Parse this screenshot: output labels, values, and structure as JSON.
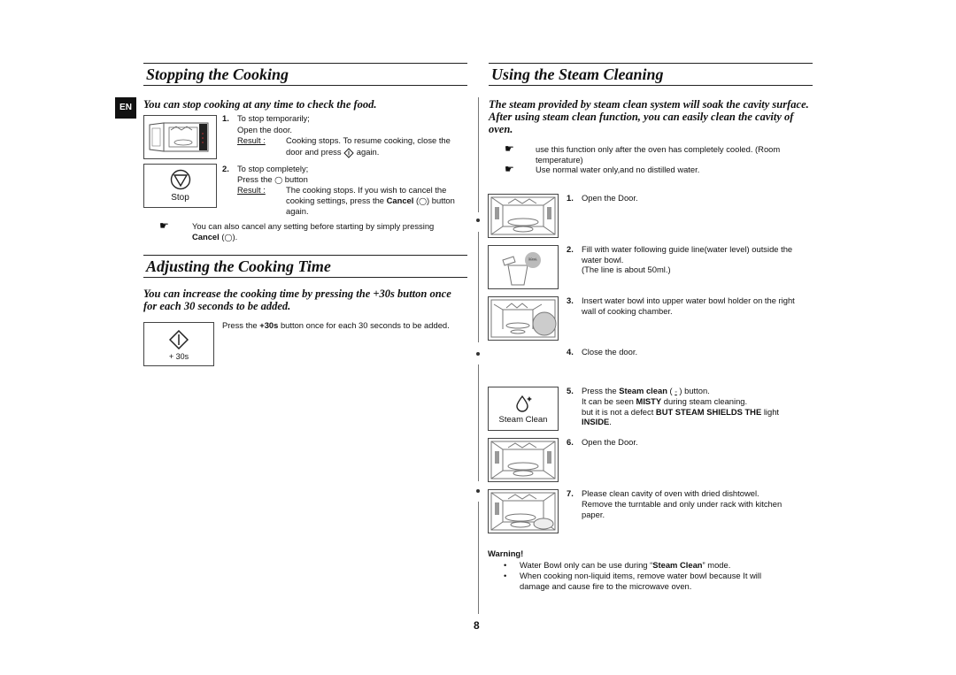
{
  "language_tab": "EN",
  "page_number": "8",
  "left": {
    "stopping": {
      "title": "Stopping the Cooking",
      "intro": "You can stop cooking at any time to check the food.",
      "step1": {
        "num": "1.",
        "line1": "To stop temporarily;",
        "line2": "Open the door.",
        "result_label": "Result :",
        "result_text_1": "Cooking stops. To resume cooking, close the",
        "result_text_2a": "door and press",
        "result_text_2b": "again."
      },
      "step2": {
        "num": "2.",
        "line1": "To stop completely;",
        "line2a": "Press the",
        "line2b": "button",
        "result_label": "Result :",
        "result_text_1": "The cooking stops. If you wish to cancel the",
        "result_text_2a": "cooking settings, press the",
        "result_text_2b": "Cancel",
        "result_text_2c": "button",
        "result_text_3": "again."
      },
      "note_1": "You can also cancel any setting before starting by simply pressing",
      "note_2a": "Cancel",
      "note_2b": ".",
      "stop_button_label": "Stop"
    },
    "adjusting": {
      "title": "Adjusting the Cooking Time",
      "intro_1": "You can increase the cooking time by pressing the +30s button once",
      "intro_2": "for each 30 seconds to be added.",
      "text_a": "Press the",
      "text_b": "+30s",
      "text_c": "button once for each 30 seconds to be added.",
      "button_label": "+ 30s"
    }
  },
  "right": {
    "title": "Using the Steam Cleaning",
    "intro_1": "The steam provided by steam clean system will soak the cavity surface.",
    "intro_2": "After using steam clean function, you can easily clean the cavity of",
    "intro_3": "oven.",
    "notes": [
      {
        "line1": "use this function only after the oven has completely cooled. (Room",
        "line2": "temperature)"
      },
      {
        "line1": "Use normal water only,and no distilled water.",
        "line2": ""
      }
    ],
    "steps": [
      {
        "num": "1.",
        "lines": [
          "Open the Door."
        ]
      },
      {
        "num": "2.",
        "lines": [
          "Fill with water following guide line(water level) outside the",
          "water bowl.",
          "(The line is about 50ml.)"
        ]
      },
      {
        "num": "3.",
        "lines": [
          "Insert water bowl into upper water bowl holder on the right",
          "wall of cooking chamber."
        ]
      },
      {
        "num": "4.",
        "lines": [
          "Close the door."
        ]
      },
      {
        "num": "5.",
        "line1a": "Press the",
        "line1b": "Steam clean",
        "line1c": "button.",
        "line2a": "It can be seen",
        "line2b": "MISTY",
        "line2c": "during steam cleaning.",
        "line3a": "but it is not a defect",
        "line3b": "BUT STEAM SHIELDS THE",
        "line3c": "light",
        "line4": "INSIDE",
        "line4b": "."
      },
      {
        "num": "6.",
        "lines": [
          "Open the Door."
        ]
      },
      {
        "num": "7.",
        "lines": [
          "Please clean cavity of oven with dried dishtowel.",
          "Remove the turntable and only under rack with kitchen",
          "paper."
        ]
      }
    ],
    "steam_button_label": "Steam Clean",
    "bowl_label": "50ml",
    "warning": {
      "title": "Warning!",
      "item1a": "Water Bowl only can be use during “",
      "item1b": "Steam Clean",
      "item1c": "” mode.",
      "item2_1": "When cooking non-liquid items, remove water bowl because It will",
      "item2_2": "damage and cause fire to the microwave oven."
    }
  }
}
